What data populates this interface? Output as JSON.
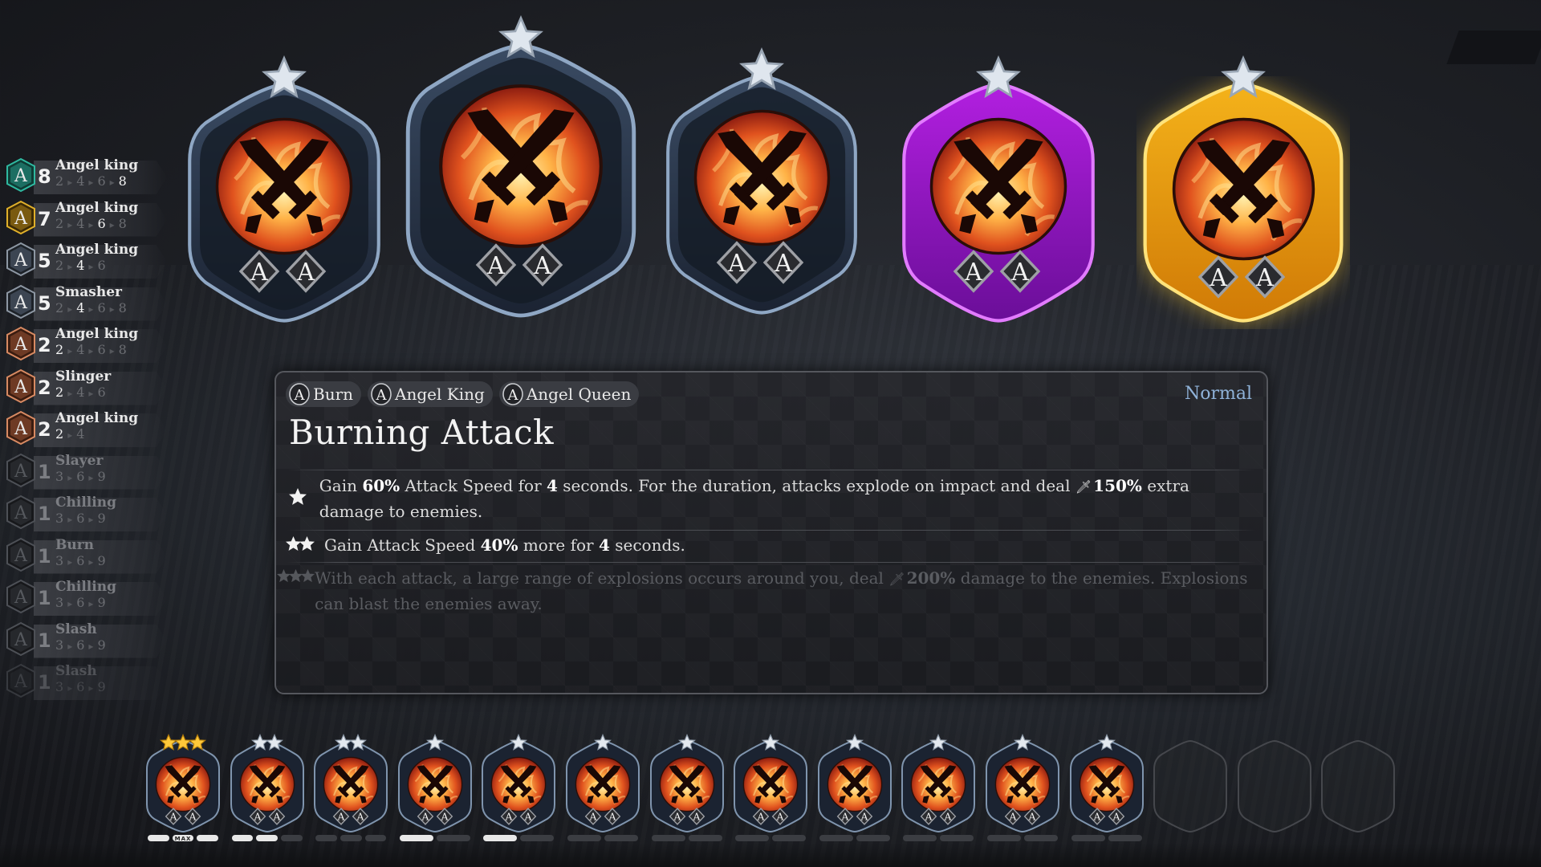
{
  "colors": {
    "accent_normal": "#8fb2d8",
    "tier_purple": "#b21fe0",
    "tier_gold": "#f4b21a",
    "tier_blue": "#4a5f7a",
    "synergy_teal": "#2fb9a0",
    "synergy_gold": "#e0b02a",
    "synergy_grey": "#8d97a3",
    "synergy_bronze": "#d88a62"
  },
  "synergies": [
    {
      "count": "8",
      "name": "Angel king",
      "thresholds": [
        "2",
        "4",
        "6",
        "8"
      ],
      "active_index": 3,
      "color": "teal",
      "dim": false,
      "icon": "synergy-hex-icon"
    },
    {
      "count": "7",
      "name": "Angel king",
      "thresholds": [
        "2",
        "4",
        "6",
        "8"
      ],
      "active_index": 2,
      "color": "gold",
      "dim": false,
      "icon": "synergy-hex-icon"
    },
    {
      "count": "5",
      "name": "Angel king",
      "thresholds": [
        "2",
        "4",
        "6"
      ],
      "active_index": 1,
      "color": "grey",
      "dim": false,
      "icon": "synergy-hex-icon"
    },
    {
      "count": "5",
      "name": "Smasher",
      "thresholds": [
        "2",
        "4",
        "6",
        "8"
      ],
      "active_index": 1,
      "color": "grey",
      "dim": false,
      "icon": "synergy-hex-icon"
    },
    {
      "count": "2",
      "name": "Angel king",
      "thresholds": [
        "2",
        "4",
        "6",
        "8"
      ],
      "active_index": 0,
      "color": "bronze",
      "dim": false,
      "icon": "synergy-hex-icon"
    },
    {
      "count": "2",
      "name": "Slinger",
      "thresholds": [
        "2",
        "4",
        "6"
      ],
      "active_index": 0,
      "color": "bronze",
      "dim": false,
      "icon": "synergy-hex-icon"
    },
    {
      "count": "2",
      "name": "Angel king",
      "thresholds": [
        "2",
        "4"
      ],
      "active_index": 0,
      "color": "bronze",
      "dim": false,
      "icon": "synergy-hex-icon"
    },
    {
      "count": "1",
      "name": "Slayer",
      "thresholds": [
        "3",
        "6",
        "9"
      ],
      "active_index": -1,
      "color": "dark",
      "dim": true,
      "icon": "synergy-hex-icon"
    },
    {
      "count": "1",
      "name": "Chilling",
      "thresholds": [
        "3",
        "6",
        "9"
      ],
      "active_index": -1,
      "color": "dark",
      "dim": true,
      "icon": "synergy-hex-icon"
    },
    {
      "count": "1",
      "name": "Burn",
      "thresholds": [
        "3",
        "6",
        "9"
      ],
      "active_index": -1,
      "color": "dark",
      "dim": true,
      "icon": "synergy-hex-icon"
    },
    {
      "count": "1",
      "name": "Chilling",
      "thresholds": [
        "3",
        "6",
        "9"
      ],
      "active_index": -1,
      "color": "dark",
      "dim": true,
      "icon": "synergy-hex-icon"
    },
    {
      "count": "1",
      "name": "Slash",
      "thresholds": [
        "3",
        "6",
        "9"
      ],
      "active_index": -1,
      "color": "dark",
      "dim": true,
      "icon": "synergy-hex-icon"
    },
    {
      "count": "1",
      "name": "Slash",
      "thresholds": [
        "3",
        "6",
        "9"
      ],
      "active_index": -1,
      "color": "dark",
      "dim": true,
      "icon": "synergy-hex-icon"
    }
  ],
  "cards": [
    {
      "tier": "blue",
      "selected": false,
      "badges": [
        "A",
        "A"
      ],
      "icon": "burning-attack-crossed-swords-icon"
    },
    {
      "tier": "blue",
      "selected": true,
      "badges": [
        "A",
        "A"
      ],
      "icon": "burning-attack-crossed-swords-icon"
    },
    {
      "tier": "blue",
      "selected": false,
      "badges": [
        "A",
        "A"
      ],
      "icon": "burning-attack-crossed-swords-icon"
    },
    {
      "tier": "purple",
      "selected": false,
      "badges": [
        "A",
        "A"
      ],
      "icon": "burning-attack-crossed-swords-icon"
    },
    {
      "tier": "gold",
      "selected": false,
      "badges": [
        "A",
        "A"
      ],
      "icon": "burning-attack-crossed-swords-icon"
    }
  ],
  "tooltip": {
    "tags": [
      {
        "icon_letter": "A",
        "label": "Burn"
      },
      {
        "icon_letter": "A",
        "label": "Angel King"
      },
      {
        "icon_letter": "A",
        "label": "Angel Queen"
      }
    ],
    "rarity": "Normal",
    "title": "Burning Attack",
    "effects": [
      {
        "stars": 1,
        "locked": false,
        "parts": [
          {
            "t": "Gain "
          },
          {
            "t": "60%",
            "b": true
          },
          {
            "t": " Attack Speed for "
          },
          {
            "t": "4",
            "b": true
          },
          {
            "t": " seconds. For the duration, attacks explode on impact and deal "
          },
          {
            "icon": "sword-icon"
          },
          {
            "t": "150%",
            "b": true
          },
          {
            "t": " extra damage to enemies."
          }
        ]
      },
      {
        "stars": 2,
        "locked": false,
        "parts": [
          {
            "t": "Gain Attack Speed "
          },
          {
            "t": "40%",
            "b": true
          },
          {
            "t": " more for "
          },
          {
            "t": "4",
            "b": true
          },
          {
            "t": " seconds."
          }
        ]
      },
      {
        "stars": 3,
        "locked": true,
        "parts": [
          {
            "t": "With each attack, a large range of explosions occurs around you, deal "
          },
          {
            "icon": "sword-icon"
          },
          {
            "t": "200%",
            "b": true
          },
          {
            "t": " damage to the enemies. Explosions can blast the enemies away."
          }
        ]
      }
    ]
  },
  "inventory": {
    "max_label": "MAX",
    "slots": [
      {
        "filled": true,
        "stars": 3,
        "star_color": "gold",
        "max": true,
        "progress": [
          1,
          1,
          1
        ]
      },
      {
        "filled": true,
        "stars": 2,
        "star_color": "silver",
        "max": false,
        "progress": [
          1,
          1,
          0
        ]
      },
      {
        "filled": true,
        "stars": 2,
        "star_color": "silver",
        "max": false,
        "progress": [
          0,
          0,
          0
        ]
      },
      {
        "filled": true,
        "stars": 1,
        "star_color": "silver",
        "max": false,
        "progress": [
          1,
          0
        ]
      },
      {
        "filled": true,
        "stars": 1,
        "star_color": "silver",
        "max": false,
        "progress": [
          1,
          0
        ]
      },
      {
        "filled": true,
        "stars": 1,
        "star_color": "silver",
        "max": false,
        "progress": [
          0,
          0
        ]
      },
      {
        "filled": true,
        "stars": 1,
        "star_color": "silver",
        "max": false,
        "progress": [
          0,
          0
        ]
      },
      {
        "filled": true,
        "stars": 1,
        "star_color": "silver",
        "max": false,
        "progress": [
          0,
          0
        ]
      },
      {
        "filled": true,
        "stars": 1,
        "star_color": "silver",
        "max": false,
        "progress": [
          0,
          0
        ]
      },
      {
        "filled": true,
        "stars": 1,
        "star_color": "silver",
        "max": false,
        "progress": [
          0,
          0
        ]
      },
      {
        "filled": true,
        "stars": 1,
        "star_color": "silver",
        "max": false,
        "progress": [
          0,
          0
        ]
      },
      {
        "filled": true,
        "stars": 1,
        "star_color": "silver",
        "max": false,
        "progress": [
          0,
          0
        ]
      },
      {
        "filled": false
      },
      {
        "filled": false
      },
      {
        "filled": false
      }
    ]
  }
}
